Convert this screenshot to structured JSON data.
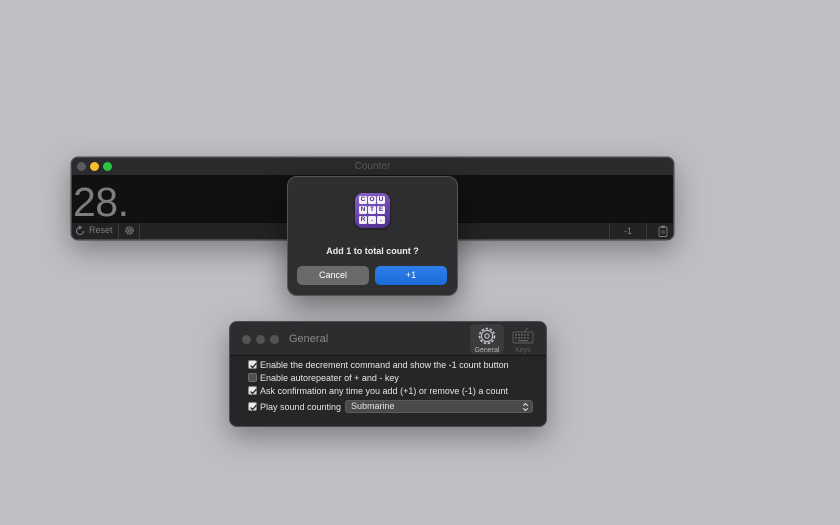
{
  "counter_window": {
    "title": "Counter",
    "count_display": "28.",
    "reset_label": "Reset",
    "decrement_label": "-1",
    "colors": {
      "close": "#5b5b5e",
      "minimize": "#f6be2e",
      "maximize": "#2cc440"
    }
  },
  "dialog": {
    "app_icon_letters": [
      "C",
      "O",
      "U",
      "N",
      "T",
      "E",
      "R",
      ".",
      "."
    ],
    "message": "Add 1 to total count ?",
    "cancel_label": "Cancel",
    "confirm_label": "+1",
    "colors": {
      "confirm": "#1a6ad8"
    }
  },
  "preferences": {
    "title": "General",
    "tabs": [
      {
        "label": "General",
        "icon": "gear-icon",
        "selected": true
      },
      {
        "label": "Keys",
        "icon": "keyboard-icon",
        "selected": false
      }
    ],
    "options": [
      {
        "label": "Enable the decrement command and show the -1 count button",
        "checked": true
      },
      {
        "label": "Enable autorepeater of + and - key",
        "checked": false
      },
      {
        "label": "Ask confirmation any time you add (+1) or remove (-1) a count",
        "checked": true
      },
      {
        "label": "Play sound counting",
        "checked": true
      }
    ],
    "sound_select": {
      "selected": "Submarine"
    }
  }
}
